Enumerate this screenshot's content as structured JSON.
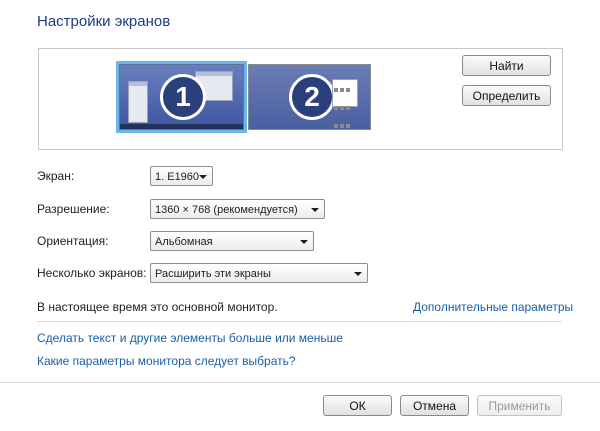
{
  "header": {
    "title": "Настройки экранов"
  },
  "preview": {
    "monitors": [
      {
        "number": "1",
        "selected": true
      },
      {
        "number": "2",
        "selected": false
      }
    ],
    "find_button": "Найти",
    "identify_button": "Определить"
  },
  "settings": {
    "display_label": "Экран:",
    "display_value": "1. E1960",
    "resolution_label": "Разрешение:",
    "resolution_value": "1360 × 768 (рекомендуется)",
    "orientation_label": "Ориентация:",
    "orientation_value": "Альбомная",
    "multiple_label": "Несколько экранов:",
    "multiple_value": "Расширить эти экраны"
  },
  "status": {
    "main_monitor_text": "В настоящее время это основной монитор.",
    "advanced_link": "Дополнительные параметры"
  },
  "links": {
    "text_size": "Сделать текст и другие элементы больше или меньше",
    "which_params": "Какие параметры монитора следует выбрать?"
  },
  "footer": {
    "ok": "ОК",
    "cancel": "Отмена",
    "apply": "Применить"
  }
}
